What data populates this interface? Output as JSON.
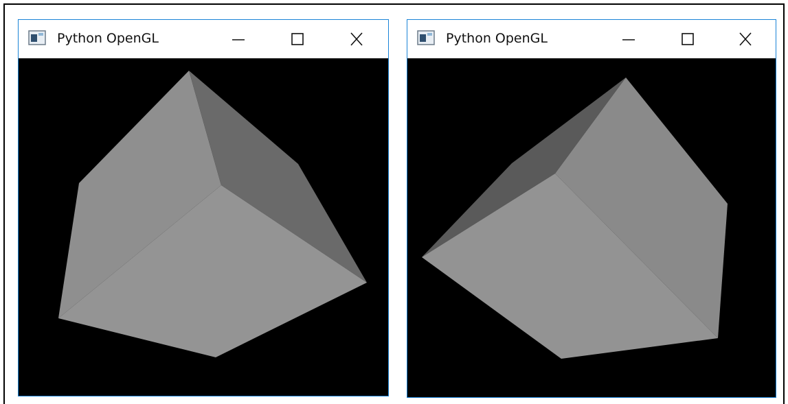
{
  "windows": [
    {
      "title": "Python OpenGL",
      "icons": [
        "app-window-icon",
        "minimize-icon",
        "maximize-icon",
        "close-icon"
      ]
    },
    {
      "title": "Python OpenGL",
      "icons": [
        "app-window-icon",
        "minimize-icon",
        "maximize-icon",
        "close-icon"
      ]
    }
  ],
  "colors": {
    "accent_border": "#1883d7",
    "face_light": "#939393",
    "face_mid": "#8a8a8a",
    "face_dark": "#6a6a6a",
    "face_darkest": "#5a5a5a",
    "background": "#000000"
  }
}
